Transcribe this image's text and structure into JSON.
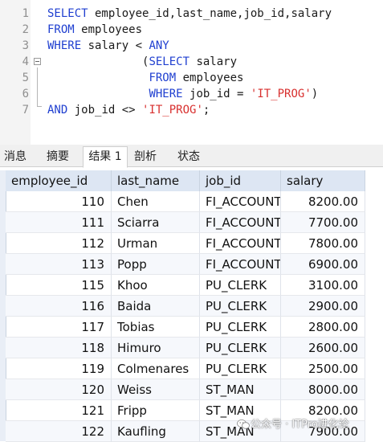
{
  "editor": {
    "lines": [
      {
        "n": "1",
        "parts": [
          [
            "kw",
            "SELECT"
          ],
          [
            "plain",
            " employee_id,last_name,job_id,salary"
          ]
        ]
      },
      {
        "n": "2",
        "parts": [
          [
            "kw",
            "FROM"
          ],
          [
            "plain",
            " employees"
          ]
        ]
      },
      {
        "n": "3",
        "parts": [
          [
            "kw",
            "WHERE"
          ],
          [
            "plain",
            " salary < "
          ],
          [
            "kw",
            "ANY"
          ]
        ]
      },
      {
        "n": "4",
        "parts": [
          [
            "plain",
            "              ("
          ],
          [
            "kw",
            "SELECT"
          ],
          [
            "plain",
            " salary"
          ]
        ]
      },
      {
        "n": "5",
        "parts": [
          [
            "plain",
            "               "
          ],
          [
            "kw",
            "FROM"
          ],
          [
            "plain",
            " employees"
          ]
        ]
      },
      {
        "n": "6",
        "parts": [
          [
            "plain",
            "               "
          ],
          [
            "kw",
            "WHERE"
          ],
          [
            "plain",
            " job_id = "
          ],
          [
            "str",
            "'IT_PROG'"
          ],
          [
            "plain",
            ")"
          ]
        ]
      },
      {
        "n": "7",
        "parts": [
          [
            "kw",
            "AND"
          ],
          [
            "plain",
            " job_id <> "
          ],
          [
            "str",
            "'IT_PROG'"
          ],
          [
            "plain",
            ";"
          ]
        ]
      }
    ]
  },
  "tabs": [
    {
      "label": "消息",
      "active": false
    },
    {
      "label": "摘要",
      "active": false
    },
    {
      "label": "结果 1",
      "active": true
    },
    {
      "label": "剖析",
      "active": false
    },
    {
      "label": "状态",
      "active": false
    }
  ],
  "table": {
    "columns": [
      "employee_id",
      "last_name",
      "job_id",
      "salary"
    ],
    "rows": [
      [
        "110",
        "Chen",
        "FI_ACCOUNT",
        "8200.00"
      ],
      [
        "111",
        "Sciarra",
        "FI_ACCOUNT",
        "7700.00"
      ],
      [
        "112",
        "Urman",
        "FI_ACCOUNT",
        "7800.00"
      ],
      [
        "113",
        "Popp",
        "FI_ACCOUNT",
        "6900.00"
      ],
      [
        "115",
        "Khoo",
        "PU_CLERK",
        "3100.00"
      ],
      [
        "116",
        "Baida",
        "PU_CLERK",
        "2900.00"
      ],
      [
        "117",
        "Tobias",
        "PU_CLERK",
        "2800.00"
      ],
      [
        "118",
        "Himuro",
        "PU_CLERK",
        "2600.00"
      ],
      [
        "119",
        "Colmenares",
        "PU_CLERK",
        "2500.00"
      ],
      [
        "120",
        "Weiss",
        "ST_MAN",
        "8000.00"
      ],
      [
        "121",
        "Fripp",
        "ST_MAN",
        "8200.00"
      ],
      [
        "122",
        "Kaufling",
        "ST_MAN",
        "7900.00"
      ]
    ]
  },
  "watermark": {
    "text": "公众号 · ITPro进化论",
    "icon": "wechat-icon"
  },
  "colors": {
    "keyword": "#1f3fd0",
    "string": "#d8302f",
    "header_bg": "#dde6f3"
  }
}
